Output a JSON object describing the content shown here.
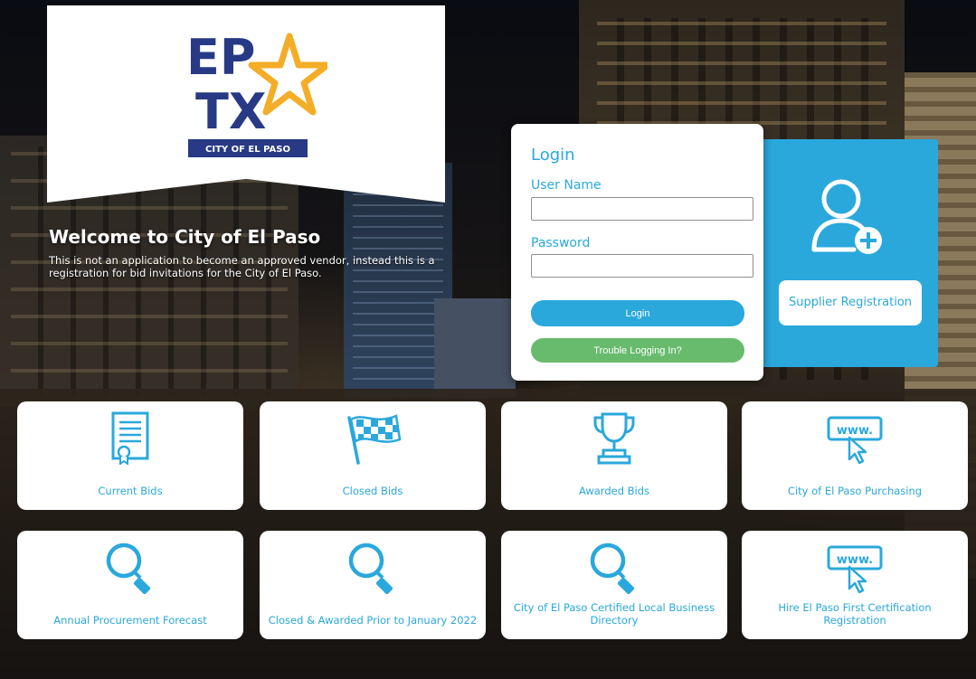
{
  "logo": {
    "line1": "EP",
    "line2": "TX",
    "tagline": "CITY OF EL PASO",
    "navy": "#283a85",
    "gold": "#f4ad27"
  },
  "welcome": {
    "title": "Welcome to City of El Paso",
    "text": "This is not an application to become an approved vendor, instead this is a registration for bid invitations for the City of El Paso."
  },
  "login": {
    "title": "Login",
    "username_label": "User Name",
    "username_value": "",
    "password_label": "Password",
    "password_value": "",
    "login_button": "Login",
    "trouble_button": "Trouble Logging In?"
  },
  "supplier": {
    "icon": "add-user-icon",
    "button_label": "Supplier Registration"
  },
  "tiles": [
    {
      "label": "Current Bids",
      "icon": "document-certificate-icon"
    },
    {
      "label": "Closed Bids",
      "icon": "checkered-flag-icon"
    },
    {
      "label": "Awarded Bids",
      "icon": "trophy-icon"
    },
    {
      "label": "City of El Paso Purchasing",
      "icon": "www-cursor-icon"
    },
    {
      "label": "Annual Procurement Forecast",
      "icon": "magnifier-icon"
    },
    {
      "label": "Closed & Awarded Prior to January 2022",
      "icon": "magnifier-icon"
    },
    {
      "label": "City of El Paso Certified Local Business Directory",
      "icon": "magnifier-icon"
    },
    {
      "label": "Hire El Paso First Certification Registration",
      "icon": "www-cursor-icon"
    }
  ],
  "colors": {
    "accent": "#2aa8dc",
    "trouble_green": "#68bb6d"
  }
}
